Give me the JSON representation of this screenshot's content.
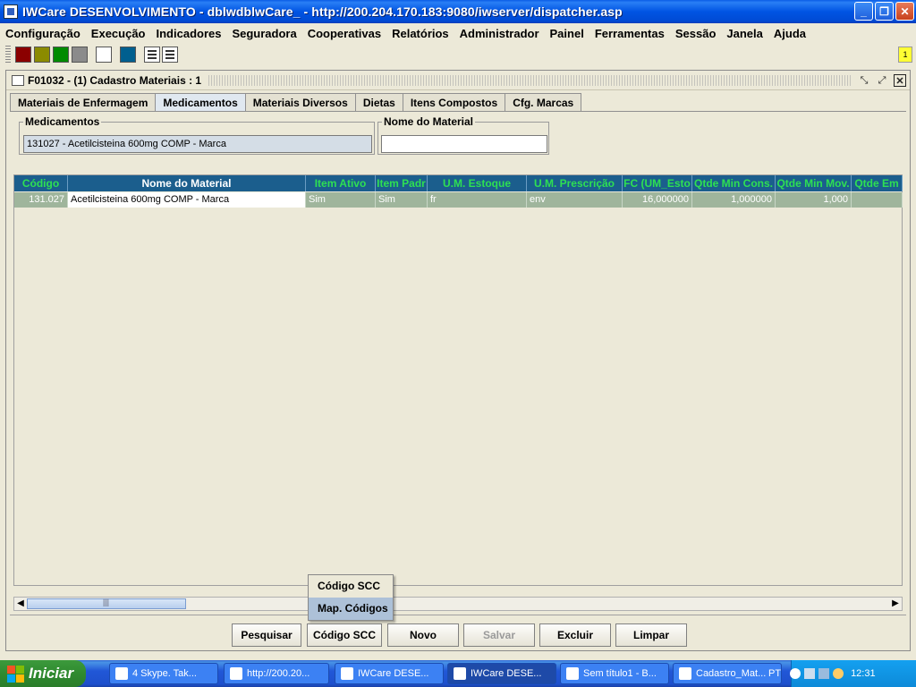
{
  "window": {
    "title": "IWCare DESENVOLVIMENTO - dblwdblwCare_ - http://200.204.170.183:9080/iwserver/dispatcher.asp",
    "minimize": "_",
    "maximize": "❐",
    "close": "✕"
  },
  "menu": [
    "Configuração",
    "Execução",
    "Indicadores",
    "Seguradora",
    "Cooperativas",
    "Relatórios",
    "Administrador",
    "Painel",
    "Ferramentas",
    "Sessão",
    "Janela",
    "Ajuda"
  ],
  "toolbar": {
    "swatches": [
      "#8b0000",
      "#8b8b00",
      "#008b00",
      "#8b8b8b",
      "#ffffff",
      "#005f8f"
    ],
    "notification": "1"
  },
  "frame": {
    "title": "F01032 - (1) Cadastro Materiais : 1",
    "tabs": [
      "Materiais de Enfermagem",
      "Medicamentos",
      "Materiais Diversos",
      "Dietas",
      "Itens Compostos",
      "Cfg. Marcas"
    ],
    "active_tab": "Medicamentos"
  },
  "filters": {
    "medicamentos_label": "Medicamentos",
    "medicamentos_value": "131027 - Acetilcisteina  600mg  COMP -    Marca",
    "nome_material_label": "Nome do Material",
    "nome_material_value": ""
  },
  "grid": {
    "columns": [
      "Código",
      "Nome do Material",
      "Item Ativo",
      "Item Padr",
      "U.M. Estoque",
      "U.M. Prescrição",
      "FC (UM_Esto",
      "Qtde Min Cons.",
      "Qtde Min Mov.",
      "Qtde Em"
    ],
    "rows": [
      [
        "131.027",
        "Acetilcisteina  600mg  COMP -    Marca",
        "Sim",
        "Sim",
        "fr",
        "env",
        "16,000000",
        "1,000000",
        "1,000",
        ""
      ]
    ]
  },
  "buttons": {
    "pesquisar": "Pesquisar",
    "codigo_scc": "Código SCC",
    "novo": "Novo",
    "salvar": "Salvar",
    "excluir": "Excluir",
    "limpar": "Limpar"
  },
  "popup": {
    "items": [
      "Código SCC",
      "Map. Códigos"
    ],
    "selected": "Map. Códigos"
  },
  "taskbar": {
    "start": "Iniciar",
    "tasks": [
      "4 Skype. Tak...",
      "http://200.20...",
      "IWCare DESE...",
      "IWCare DESE...",
      "Sem título1 - B...",
      "Cadastro_Mat..."
    ],
    "language": "PT",
    "clock": "12:31"
  }
}
